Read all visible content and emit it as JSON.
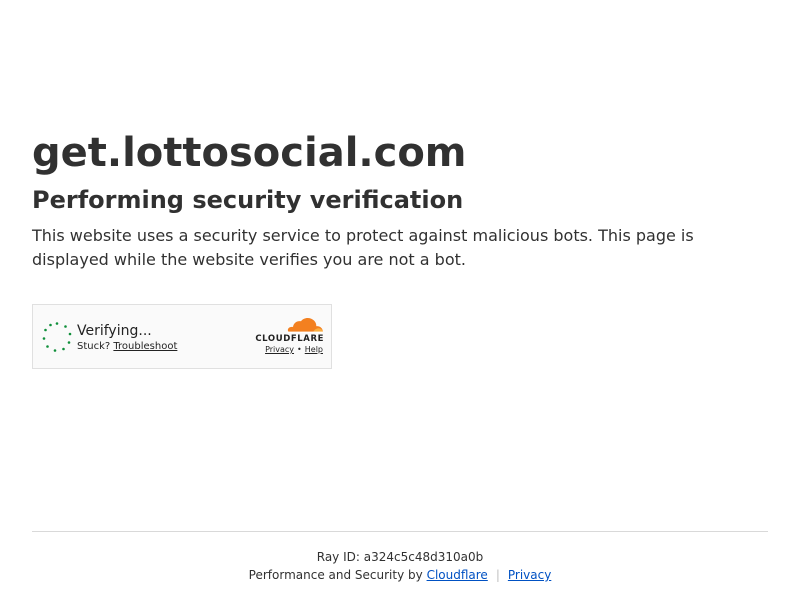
{
  "header": {
    "site_title": "get.lottosocial.com",
    "subtitle": "Performing security verification",
    "description": "This website uses a security service to protect against malicious bots. This page is displayed while the website verifies you are not a bot."
  },
  "widget": {
    "status": "Verifying...",
    "stuck_label": "Stuck?",
    "troubleshoot_label": "Troubleshoot",
    "brand_wordmark": "CLOUDFLARE",
    "privacy_label": "Privacy",
    "separator": "•",
    "help_label": "Help",
    "spinner_icon": "loading-spinner-icon",
    "brand_color": "#f38020",
    "brand_color_light": "#faae40"
  },
  "footer": {
    "ray_id_label": "Ray ID:",
    "ray_id_value": "a324c5c48d310a0b",
    "perf_text": "Performance and Security by",
    "cloudflare_link": "Cloudflare",
    "separator": "|",
    "privacy_link": "Privacy",
    "link_color": "#0051c3"
  }
}
